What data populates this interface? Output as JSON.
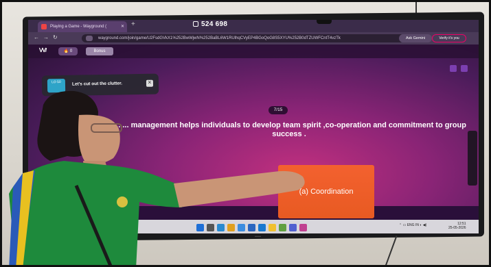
{
  "browser": {
    "tab_title": "Playing a Game - Wayground (",
    "new_tab": "+",
    "game_code": "524 698",
    "url": "wayground.com/join/game/U2FsdGVkX1%252BwWjwN%252BaBL6W1RUlhqCVyEP4BGoQoG8S5XYU%252B0dTZUWFCntT4vzTk",
    "ask_gemini": "Ask Gemini",
    "verify": "Verify it's you"
  },
  "game": {
    "streak_count": "0",
    "bonus_label": "Bonus",
    "popup_badge": "LO 50",
    "popup_text": "Let's cut out the clutter.",
    "counter": "7/15",
    "question": "........ management helps individuals to develop team spirit ,co-operation and commitment to group success .",
    "answer": "(a) Coordination"
  },
  "taskbar": {
    "lang": "ENG IN",
    "time": "12:51",
    "date": "25-05-2026"
  },
  "colors": {
    "answer_bg": "#ef5e28",
    "game_bg": "#8a2476",
    "shirt": "#1e8a3c"
  }
}
